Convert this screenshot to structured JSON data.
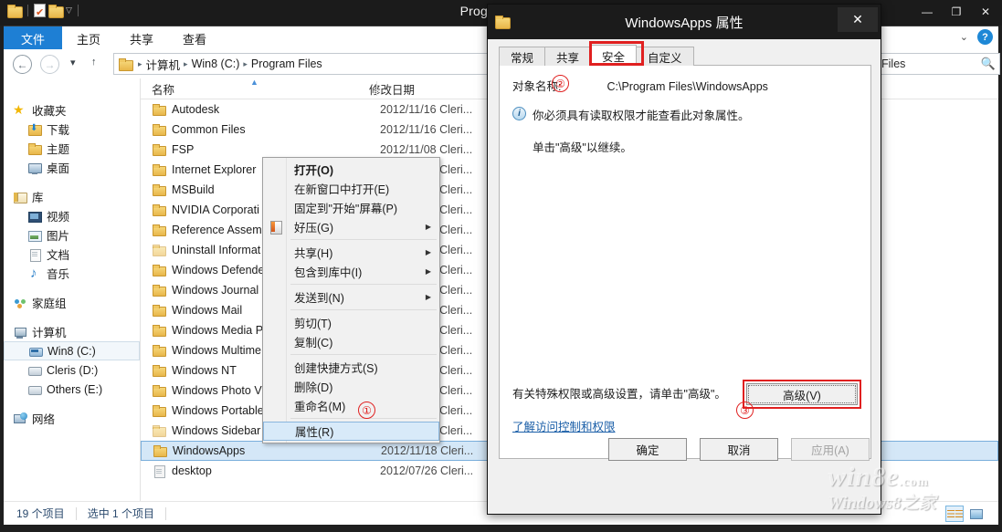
{
  "window": {
    "title": "Program Files",
    "quick_access": [
      "folder-icon",
      "properties-doc-icon",
      "new-folder-icon",
      "customize-caret-icon"
    ],
    "controls": {
      "minimize": "—",
      "maximize": "❐",
      "close": "✕"
    }
  },
  "ribbon": {
    "tabs": [
      {
        "label": "文件",
        "active": true
      },
      {
        "label": "主页",
        "active": false
      },
      {
        "label": "共享",
        "active": false
      },
      {
        "label": "查看",
        "active": false
      }
    ],
    "expand_caret": "⌄",
    "help_label": "?"
  },
  "address_bar": {
    "back": "←",
    "forward": "→",
    "recent": "▾",
    "up": "↑",
    "breadcrumb": [
      "计算机",
      "Win8 (C:)",
      "Program Files"
    ],
    "separator": "▸",
    "search_value": "Files",
    "search_icon": "search-icon"
  },
  "sidebar": {
    "groups": [
      {
        "header": {
          "label": "收藏夹",
          "icon": "star-icon"
        },
        "items": [
          {
            "label": "下载",
            "icon": "downloads-icon"
          },
          {
            "label": "主题",
            "icon": "folder-icon"
          },
          {
            "label": "桌面",
            "icon": "desktop-icon"
          }
        ]
      },
      {
        "header": {
          "label": "库",
          "icon": "library-icon"
        },
        "items": [
          {
            "label": "视频",
            "icon": "video-icon"
          },
          {
            "label": "图片",
            "icon": "pictures-icon"
          },
          {
            "label": "文档",
            "icon": "documents-icon"
          },
          {
            "label": "音乐",
            "icon": "music-icon"
          }
        ]
      },
      {
        "header": {
          "label": "家庭组",
          "icon": "homegroup-icon"
        },
        "items": []
      },
      {
        "header": {
          "label": "计算机",
          "icon": "computer-icon"
        },
        "items": [
          {
            "label": "Win8 (C:)",
            "icon": "system-drive-icon",
            "selected": true
          },
          {
            "label": "Cleris (D:)",
            "icon": "drive-icon"
          },
          {
            "label": "Others (E:)",
            "icon": "drive-icon"
          }
        ]
      },
      {
        "header": {
          "label": "网络",
          "icon": "network-icon"
        },
        "items": []
      }
    ]
  },
  "file_list": {
    "columns": [
      {
        "label": "名称",
        "sorted": true,
        "sort_arrow": "▲"
      },
      {
        "label": "修改日期"
      }
    ],
    "rows": [
      {
        "name": "Autodesk",
        "date": "2012/11/16 Cleri...",
        "icon": "folder-icon"
      },
      {
        "name": "Common Files",
        "date": "2012/11/16 Cleri...",
        "icon": "folder-icon"
      },
      {
        "name": "FSP",
        "date": "2012/11/08 Cleri...",
        "icon": "folder-icon"
      },
      {
        "name": "Internet Explorer",
        "date": "2012/11/07 Cleri...",
        "icon": "folder-icon"
      },
      {
        "name": "MSBuild",
        "date": "2012/11/08 Cleri...",
        "icon": "folder-icon"
      },
      {
        "name": "NVIDIA Corporati",
        "date": "2012/11/13 Cleri...",
        "icon": "folder-icon"
      },
      {
        "name": "Reference Assembl",
        "date": "2012/11/08 Cleri...",
        "icon": "folder-icon"
      },
      {
        "name": "Uninstall Informat",
        "date": "2012/11/16 Cleri...",
        "icon": "folder-icon-dim"
      },
      {
        "name": "Windows Defende",
        "date": "2012/11/16 Cleri...",
        "icon": "folder-icon"
      },
      {
        "name": "Windows Journal",
        "date": "2012/11/16 Cleri...",
        "icon": "folder-icon"
      },
      {
        "name": "Windows Mail",
        "date": "2012/11/16 Cleri...",
        "icon": "folder-icon"
      },
      {
        "name": "Windows Media P",
        "date": "2012/11/15 Cleri...",
        "icon": "folder-icon"
      },
      {
        "name": "Windows Multime",
        "date": "2012/11/16 Cleri...",
        "icon": "folder-icon"
      },
      {
        "name": "Windows NT",
        "date": "2012/11/08 Cleri...",
        "icon": "folder-icon"
      },
      {
        "name": "Windows Photo V",
        "date": "2012/11/16 Cleri...",
        "icon": "folder-icon"
      },
      {
        "name": "Windows Portable",
        "date": "2012/11/16 Cleri...",
        "icon": "folder-icon"
      },
      {
        "name": "Windows Sidebar",
        "date": "2012/11/16 Cleri...",
        "icon": "folder-icon-dim"
      },
      {
        "name": "WindowsApps",
        "date": "2012/11/18 Cleri...",
        "icon": "folder-icon",
        "selected": true
      },
      {
        "name": "desktop",
        "date": "2012/07/26 Cleri...",
        "icon": "file-icon"
      }
    ]
  },
  "status_bar": {
    "item_count": "19 个项目",
    "selection": "选中 1 个项目",
    "view_buttons": [
      {
        "name": "details-view-button",
        "active": true
      },
      {
        "name": "large-icons-view-button",
        "active": false
      }
    ]
  },
  "context_menu": {
    "items": [
      {
        "label": "打开(O)",
        "bold": true
      },
      {
        "label": "在新窗口中打开(E)"
      },
      {
        "label": "固定到\"开始\"屏幕(P)"
      },
      {
        "label": "好压(G)",
        "submenu": true,
        "icon": "haozip-icon"
      },
      {
        "separator": true
      },
      {
        "label": "共享(H)",
        "submenu": true
      },
      {
        "label": "包含到库中(I)",
        "submenu": true
      },
      {
        "separator": true
      },
      {
        "label": "发送到(N)",
        "submenu": true
      },
      {
        "separator": true
      },
      {
        "label": "剪切(T)"
      },
      {
        "label": "复制(C)"
      },
      {
        "separator": true
      },
      {
        "label": "创建快捷方式(S)"
      },
      {
        "label": "删除(D)"
      },
      {
        "label": "重命名(M)"
      },
      {
        "separator": true
      },
      {
        "label": "属性(R)",
        "selected": true
      }
    ]
  },
  "annotations": {
    "one": "①",
    "two": "②",
    "three": "③"
  },
  "dialog": {
    "title": "WindowsApps 属性",
    "close_label": "✕",
    "tabs": [
      {
        "label": "常规",
        "active": false
      },
      {
        "label": "共享",
        "active": false
      },
      {
        "label": "安全",
        "active": true,
        "highlighted": true
      },
      {
        "label": "自定义",
        "active": false
      }
    ],
    "object_name_label": "对象名称:",
    "object_path": "C:\\Program Files\\WindowsApps",
    "info_icon": "info-icon",
    "info_line1": "你必须具有读取权限才能查看此对象属性。",
    "info_line2": "单击\"高级\"以继续。",
    "hint_text": "有关特殊权限或高级设置，请单击\"高级\"。",
    "advanced_button": "高级(V)",
    "link_text": "了解访问控制和权限",
    "footer_buttons": [
      {
        "label": "确定",
        "disabled": false
      },
      {
        "label": "取消",
        "disabled": false
      },
      {
        "label": "应用(A)",
        "disabled": true
      }
    ]
  },
  "watermark": {
    "line1": "win8e",
    "line1_suffix": ".com",
    "line2": "Windows8之家"
  }
}
